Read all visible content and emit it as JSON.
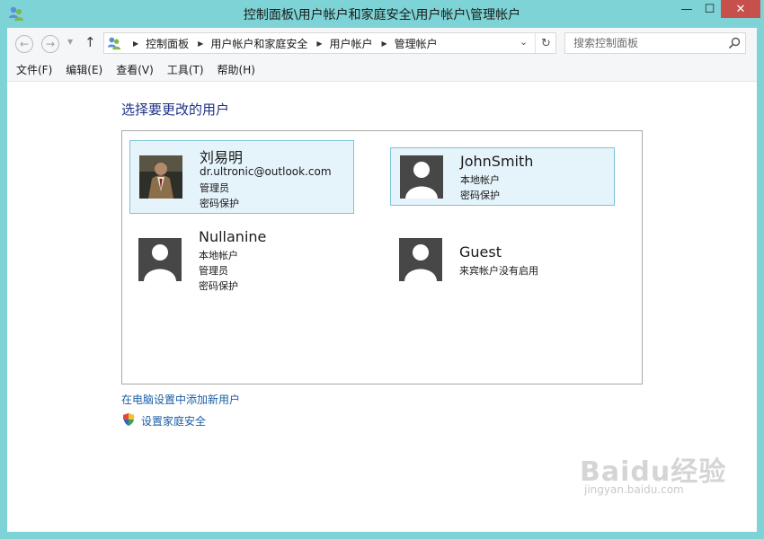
{
  "window": {
    "title": "控制面板\\用户帐户和家庭安全\\用户帐户\\管理帐户",
    "controls": {
      "minimize": "—",
      "maximize": "☐",
      "close": "✕"
    }
  },
  "nav": {
    "back_icon": "←",
    "forward_icon": "→",
    "dropdown_icon": "▼",
    "up_icon": "↑",
    "breadcrumbs": [
      "控制面板",
      "用户帐户和家庭安全",
      "用户帐户",
      "管理帐户"
    ],
    "breadcrumb_separator": "▶",
    "address_dropdown_icon": "⌄",
    "refresh_icon": "↻",
    "search_placeholder": "搜索控制面板"
  },
  "menu": {
    "items": [
      "文件(F)",
      "编辑(E)",
      "查看(V)",
      "工具(T)",
      "帮助(H)"
    ]
  },
  "main": {
    "heading": "选择要更改的用户",
    "users": [
      {
        "name": "刘易明",
        "lines": [
          "dr.ultronic@outlook.com",
          "管理员",
          "密码保护"
        ],
        "avatar": "photo",
        "selected": true
      },
      {
        "name": "JohnSmith",
        "lines": [
          "本地帐户",
          "密码保护"
        ],
        "avatar": "silhouette",
        "selected": true
      },
      {
        "name": "Nullanine",
        "lines": [
          "本地帐户",
          "管理员",
          "密码保护"
        ],
        "avatar": "silhouette",
        "selected": false
      },
      {
        "name": "Guest",
        "lines": [
          "来宾帐户没有启用"
        ],
        "avatar": "silhouette",
        "selected": false
      }
    ],
    "add_user_link": "在电脑设置中添加新用户",
    "family_safety_link": "设置家庭安全"
  },
  "watermark": {
    "logo_text": "Baidu经验",
    "url": "jingyan.baidu.com"
  },
  "colors": {
    "frame": "#7dd3d5",
    "heading": "#1e3287",
    "link": "#1b5ea5",
    "selected_bg": "#e5f3fb",
    "selected_border": "#7dc3d8",
    "close_button": "#c7504c",
    "avatar_bg": "#474747"
  }
}
